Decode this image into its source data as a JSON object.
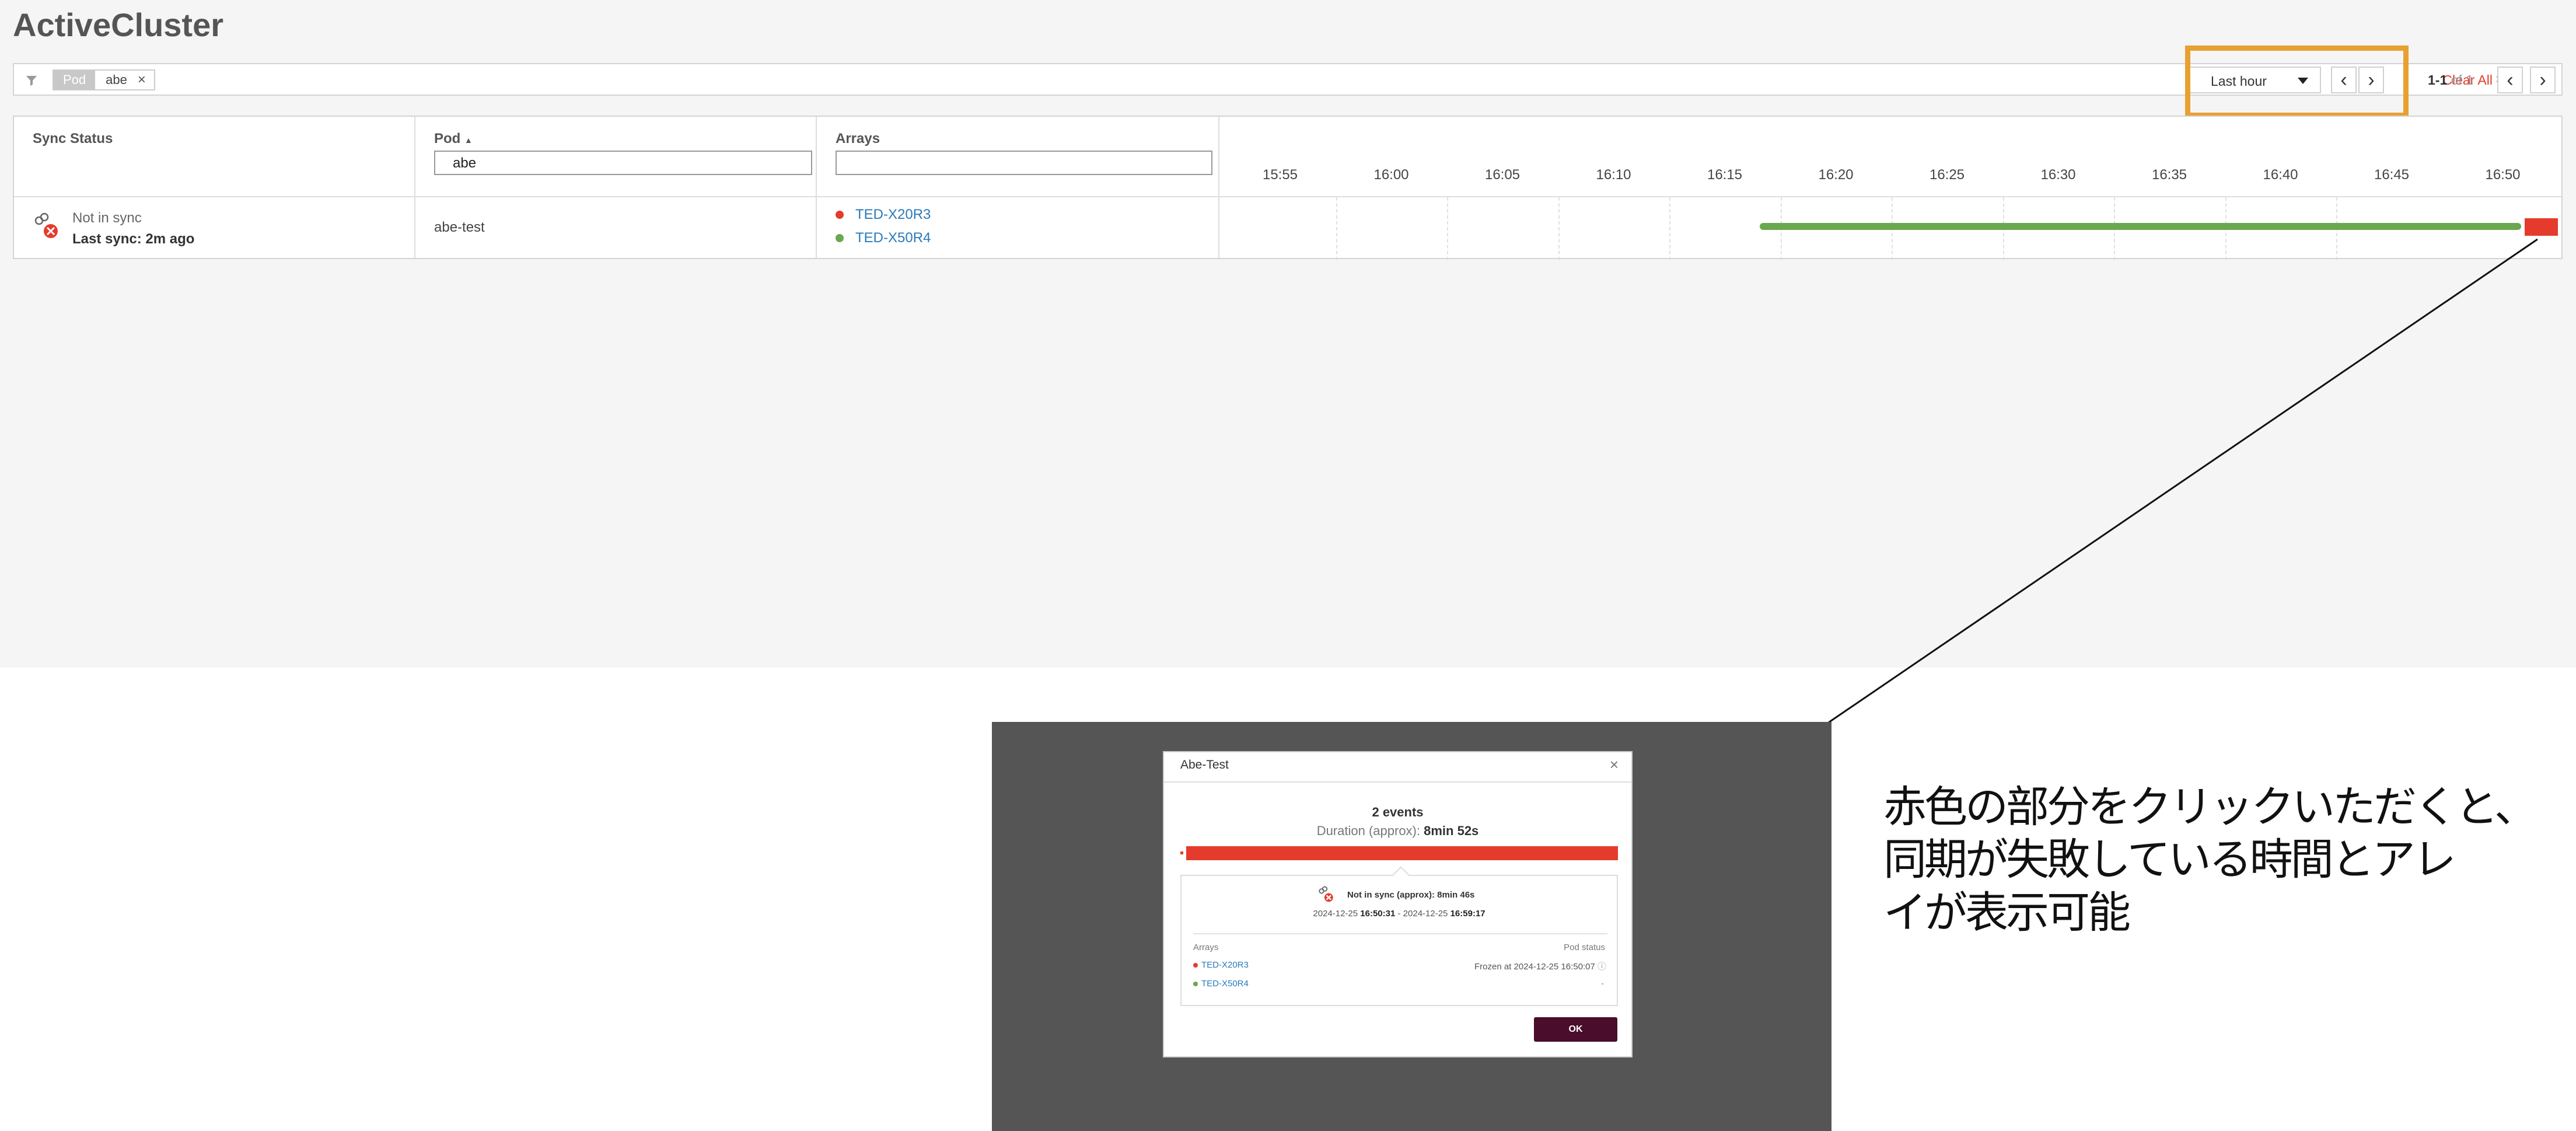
{
  "page": {
    "title": "ActiveCluster"
  },
  "filter": {
    "icon": "filter-icon",
    "chip_key": "Pod",
    "chip_value": "abe",
    "chip_close": "×",
    "clear_all": "Clear All",
    "clear_icon": "×"
  },
  "time_range": {
    "selected": "Last hour",
    "prev": "‹",
    "next": "›",
    "highlight_color": "#e8a030"
  },
  "pagination": {
    "range": "1-1",
    "of": "of 1",
    "prev": "‹",
    "next": "›"
  },
  "table": {
    "columns": {
      "sync_status": "Sync Status",
      "pod": "Pod",
      "pod_sort": "▲",
      "arrays": "Arrays"
    },
    "pod_filter_value": "abe",
    "arrays_filter_value": "",
    "timeline_ticks": [
      "15:55",
      "16:00",
      "16:05",
      "16:10",
      "16:15",
      "16:20",
      "16:25",
      "16:30",
      "16:35",
      "16:40",
      "16:45",
      "16:50"
    ],
    "rows": [
      {
        "status": "Not in sync",
        "last_sync": "Last sync: 2m ago",
        "pod": "abe-test",
        "arrays": [
          {
            "name": "TED-X20R3",
            "color": "#e53b2c"
          },
          {
            "name": "TED-X50R4",
            "color": "#6aa84f"
          }
        ]
      }
    ],
    "colors": {
      "in_sync": "#6aa84f",
      "not_in_sync": "#e53b2c"
    }
  },
  "dialog": {
    "title": "Abe-Test",
    "close": "×",
    "events": "2 events",
    "duration_label": "Duration (approx):",
    "duration_value": "8min 52s",
    "detail_title": "Not in sync (approx): 8min 46s",
    "detail_prefix_a": "2024-12-25",
    "detail_time_a": "16:50:31",
    "detail_sep": " - ",
    "detail_prefix_b": "2024-12-25",
    "detail_time_b": "16:59:17",
    "arrays_header": "Arrays",
    "status_header": "Pod status",
    "arrays": [
      {
        "name": "TED-X20R3",
        "color": "#e53b2c",
        "status": "Frozen at 2024-12-25 16:50:07"
      },
      {
        "name": "TED-X50R4",
        "color": "#6aa84f",
        "status": "-"
      }
    ],
    "ok": "OK"
  },
  "annotation": {
    "lines": [
      "赤色の部分をクリックいただくと、",
      "同期が失敗している時間とアレ",
      "イが表示可能"
    ]
  }
}
